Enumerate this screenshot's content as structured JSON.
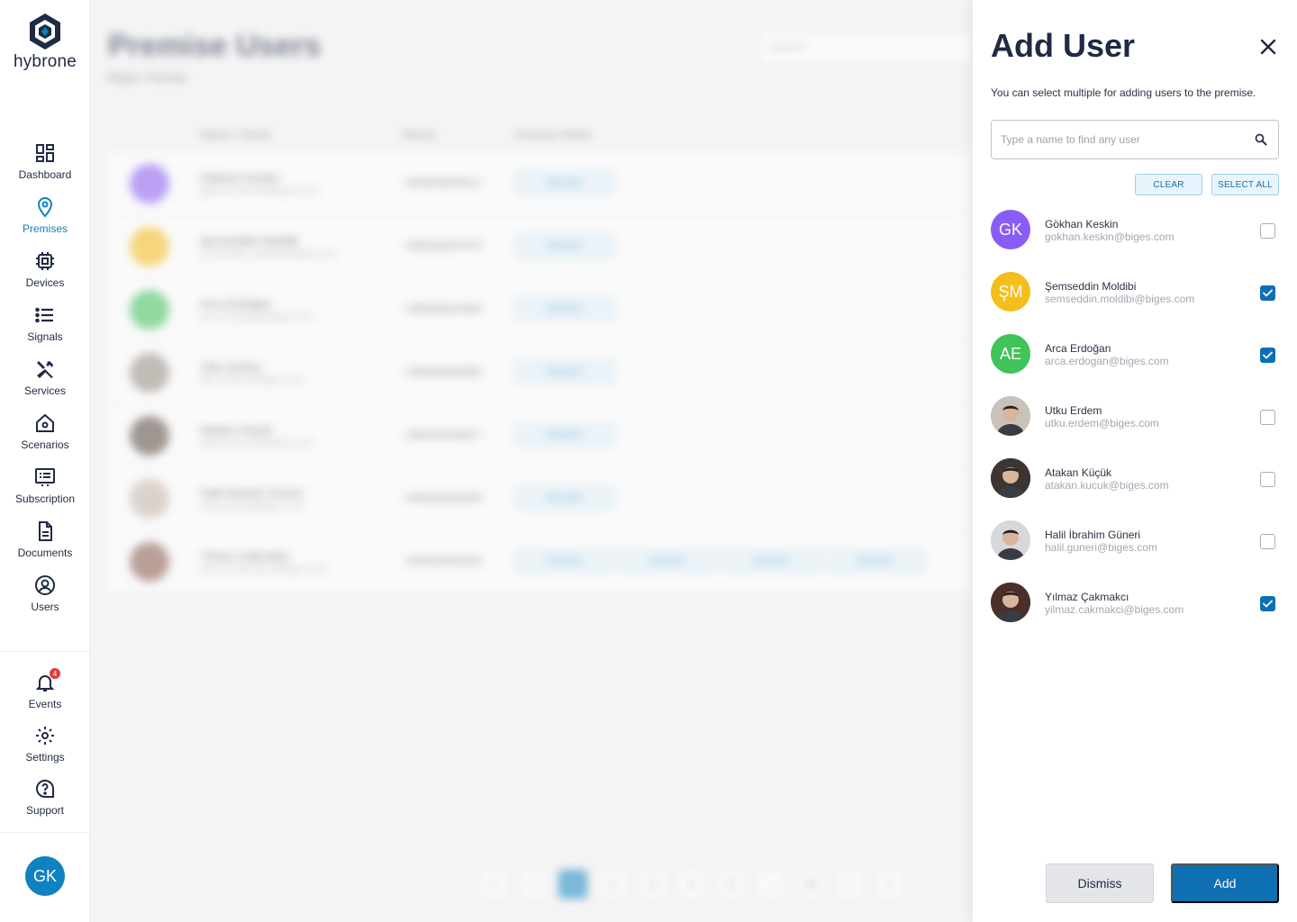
{
  "logo": {
    "text": "hybrone"
  },
  "nav": {
    "items": [
      {
        "label": "Dashboard",
        "icon": "dashboard-icon"
      },
      {
        "label": "Premises",
        "icon": "location-pin-icon",
        "active": true
      },
      {
        "label": "Devices",
        "icon": "chip-icon"
      },
      {
        "label": "Signals",
        "icon": "list-icon"
      },
      {
        "label": "Services",
        "icon": "tools-icon"
      },
      {
        "label": "Scenarios",
        "icon": "home-gear-icon"
      },
      {
        "label": "Subscription",
        "icon": "subscription-icon"
      },
      {
        "label": "Documents",
        "icon": "document-icon"
      },
      {
        "label": "Users",
        "icon": "user-circle-icon"
      }
    ],
    "bottom": [
      {
        "label": "Events",
        "icon": "bell-icon",
        "badge": "4"
      },
      {
        "label": "Settings",
        "icon": "gear-icon"
      },
      {
        "label": "Support",
        "icon": "help-icon"
      }
    ]
  },
  "current_user": {
    "initials": "GK"
  },
  "background": {
    "title": "Premise Users",
    "subtitle": "Biges Famas",
    "search_placeholder": "Search",
    "columns": [
      "Name / Email",
      "Phone",
      "Premise Roles"
    ],
    "rows": [
      {
        "name": "Gökhan Keskin",
        "email": "gokhan.keskin@biges.com",
        "phone": "+905555555511",
        "initials": "GK",
        "color": "#8a5cf6",
        "tags": [
          "Member"
        ]
      },
      {
        "name": "Şemseddin Moldibi",
        "email": "semseddin.moldibi@biges.com",
        "phone": "+905555557070",
        "initials": "ŞM",
        "color": "#f6be1b",
        "tags": [
          "Member"
        ]
      },
      {
        "name": "Arca Erdoğan",
        "email": "arca.erdogan@biges.com",
        "phone": "+905555553360",
        "initials": "AE",
        "color": "#3fc35a",
        "tags": [
          "Member"
        ]
      },
      {
        "name": "Utku Erdem",
        "email": "utku.erdem@biges.com",
        "phone": "+905555558080",
        "initials": "",
        "color": "#9a8f85",
        "tags": [
          "Member"
        ]
      },
      {
        "name": "Atakan Küçük",
        "email": "atakan.kucuk@biges.com",
        "phone": "+905555559817",
        "initials": "",
        "color": "#5b4b40",
        "tags": [
          "Member"
        ]
      },
      {
        "name": "Halil İbrahim Güneri",
        "email": "halil.guneri@biges.com",
        "phone": "+905555555555",
        "initials": "",
        "color": "#c9b8ac",
        "tags": [
          "Member"
        ]
      },
      {
        "name": "Yılmaz Çakmakcı",
        "email": "yilmaz.cakmakci@biges.com",
        "phone": "+905555556300",
        "initials": "",
        "color": "#8c5b4c",
        "tags": [
          "Member",
          "Member",
          "Member",
          "Member"
        ]
      }
    ],
    "pagination": [
      "«",
      "‹",
      "1",
      "2",
      "3",
      "4",
      "5",
      "...",
      "10",
      "›",
      "»"
    ]
  },
  "panel": {
    "title": "Add User",
    "description": "You can select multiple for adding users to the premise.",
    "search_placeholder": "Type a name to find any user",
    "clear_label": "CLEAR",
    "select_all_label": "SELECT ALL",
    "users": [
      {
        "name": "Gökhan Keskin",
        "email": "gokhan.keskin@biges.com",
        "initials": "GK",
        "color": "#8a5cf6",
        "photo": false,
        "checked": false
      },
      {
        "name": "Şemseddin Moldibi",
        "email": "semseddin.moldibi@biges.com",
        "initials": "ŞM",
        "color": "#f6be1b",
        "photo": false,
        "checked": true
      },
      {
        "name": "Arca Erdoğan",
        "email": "arca.erdogan@biges.com",
        "initials": "AE",
        "color": "#3fc35a",
        "photo": false,
        "checked": true
      },
      {
        "name": "Utku Erdem",
        "email": "utku.erdem@biges.com",
        "initials": "",
        "color": "#c9c2bb",
        "photo": true,
        "checked": false
      },
      {
        "name": "Atakan Küçük",
        "email": "atakan.kucuk@biges.com",
        "initials": "",
        "color": "#3c3531",
        "photo": true,
        "checked": false
      },
      {
        "name": "Halil İbrahim Güneri",
        "email": "halil.guneri@biges.com",
        "initials": "",
        "color": "#d8d8da",
        "photo": true,
        "checked": false
      },
      {
        "name": "Yılmaz Çakmakcı",
        "email": "yilmaz.cakmakci@biges.com",
        "initials": "",
        "color": "#4a2f2a",
        "photo": true,
        "checked": true
      }
    ],
    "dismiss_label": "Dismiss",
    "add_label": "Add"
  },
  "colors": {
    "accent": "#0f82c0",
    "primary_button": "#0f6fb3",
    "text_dark": "#1f2a44"
  }
}
